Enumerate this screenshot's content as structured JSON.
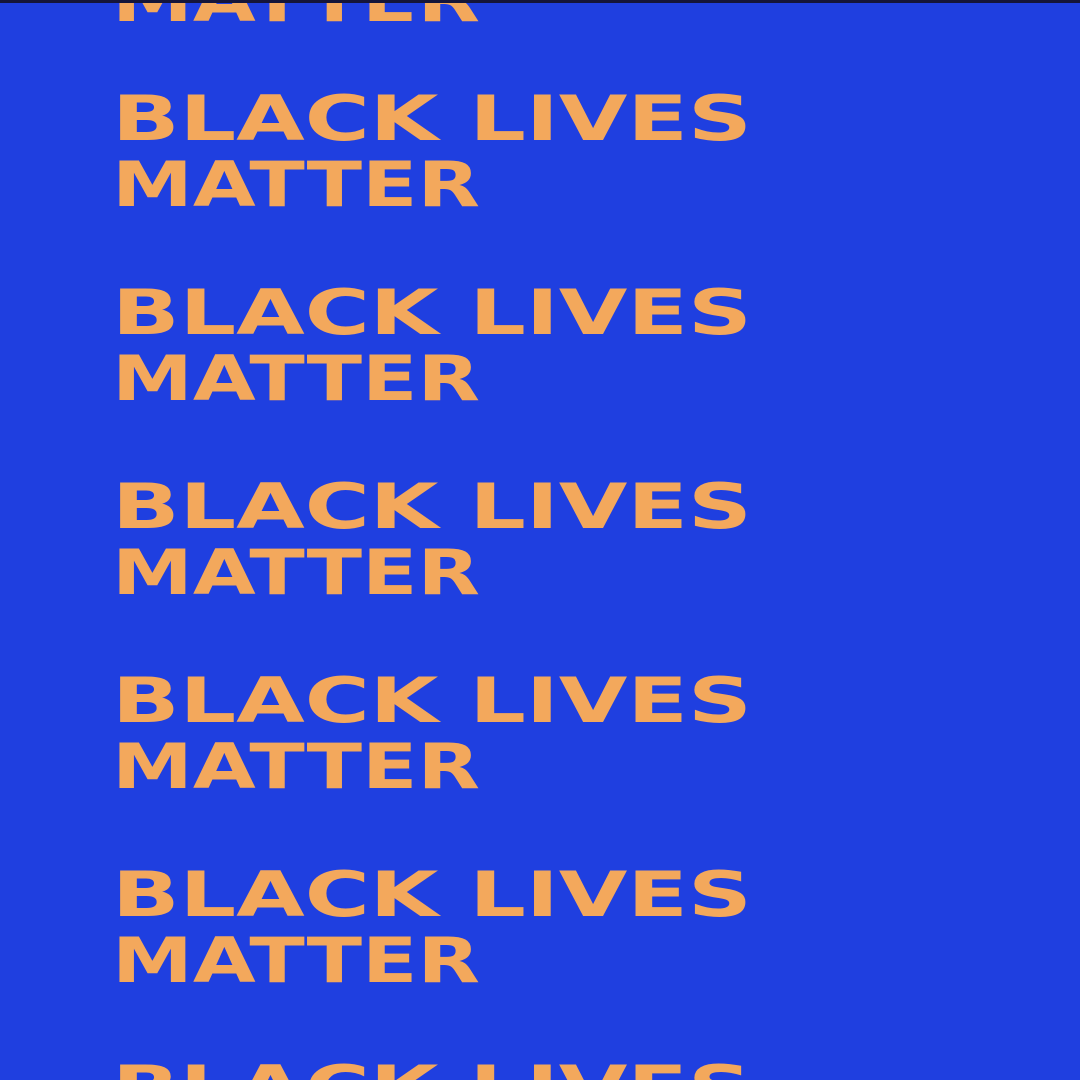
{
  "poster": {
    "background_color": "#1f3fe0",
    "text_color": "#f3a85c",
    "lines": [
      "MATTER",
      "BLACK LIVES",
      "MATTER",
      "BLACK LIVES",
      "MATTER",
      "BLACK LIVES",
      "MATTER",
      "BLACK LIVES",
      "MATTER",
      "BLACK LIVES",
      "MATTER",
      "BLACK LIVES"
    ]
  }
}
